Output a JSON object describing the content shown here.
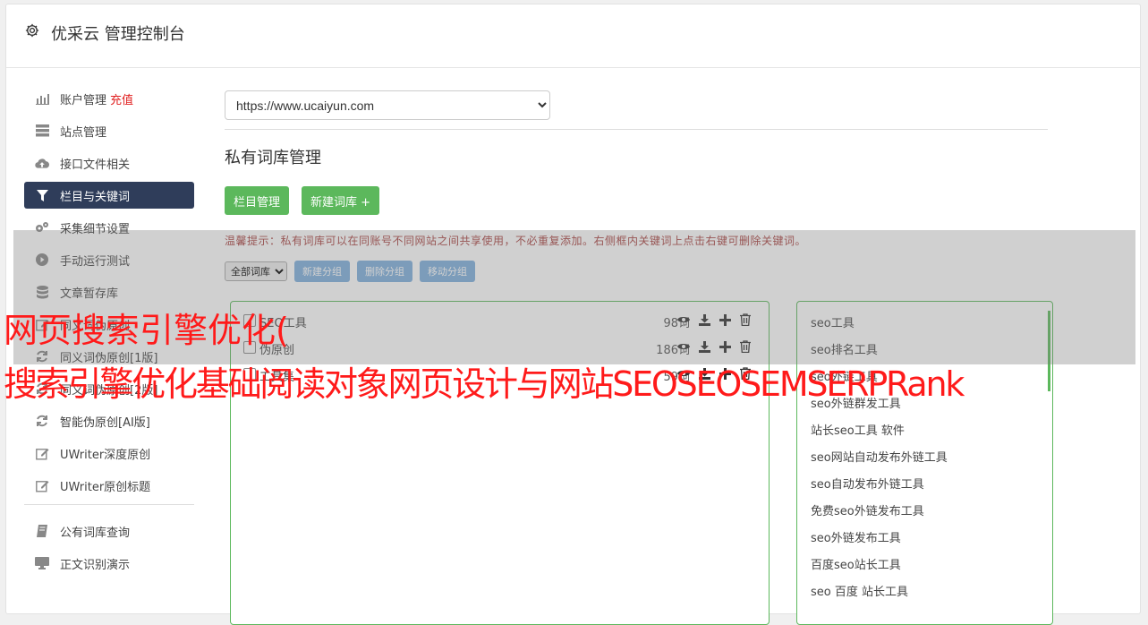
{
  "header": {
    "title": "优采云 管理控制台",
    "icon": "gear-icon"
  },
  "sidebar": {
    "items": [
      {
        "label": "账户管理",
        "badge": "充值",
        "icon": "bar-chart-icon"
      },
      {
        "label": "站点管理",
        "icon": "server-icon"
      },
      {
        "label": "接口文件相关",
        "icon": "cloud-upload-icon"
      },
      {
        "label": "栏目与关键词",
        "icon": "filter-icon",
        "active": true
      },
      {
        "label": "采集细节设置",
        "icon": "gears-icon"
      },
      {
        "label": "手动运行测试",
        "icon": "play-circle-icon"
      },
      {
        "label": "文章暂存库",
        "icon": "database-icon"
      },
      {
        "label": "同义词伪原创",
        "icon": "edit-icon"
      },
      {
        "label": "同义词伪原创[1版]",
        "icon": "refresh-icon"
      },
      {
        "label": "同义词伪原创[2版]",
        "icon": "refresh-icon"
      },
      {
        "label": "智能伪原创[AI版]",
        "icon": "refresh-icon"
      },
      {
        "label": "UWriter深度原创",
        "icon": "edit-icon"
      },
      {
        "label": "UWriter原创标题",
        "icon": "edit-icon"
      }
    ],
    "items2": [
      {
        "label": "公有词库查询",
        "icon": "book-icon"
      },
      {
        "label": "正文识别演示",
        "icon": "monitor-icon"
      }
    ]
  },
  "main": {
    "site_url": "https://www.ucaiyun.com",
    "section_title": "私有词库管理",
    "btn_columns": "栏目管理",
    "btn_new_lib": "新建词库 +",
    "tip": "温馨提示：私有词库可以在同账号不同网站之间共享使用，不必重复添加。右侧框内关键词上点击右键可删除关键词。",
    "filter_select": "全部词库",
    "btn_new_group": "新建分组",
    "btn_delete_group": "删除分组",
    "btn_move_group": "移动分组",
    "libraries": [
      {
        "name": "SEO工具",
        "count": "98词"
      },
      {
        "name": "伪原创",
        "count": "186词"
      },
      {
        "name": "工具集",
        "count": "59词"
      }
    ],
    "keywords": [
      "seo工具",
      "seo排名工具",
      "seo外链工具",
      "seo外链群发工具",
      "站长seo工具 软件",
      "seo网站自动发布外链工具",
      "seo自动发布外链工具",
      "免费seo外链发布工具",
      "seo外链发布工具",
      "百度seo站长工具",
      "seo 百度 站长工具"
    ]
  },
  "overlay": {
    "line1": "网页搜索引擎优化(",
    "line2": "搜索引擎优化基础阅读对象网页设计与网站SEOSEOSEMSERPRank"
  },
  "colors": {
    "accent_green": "#5cb85c",
    "active_nav": "#2f3d5a",
    "tip_red": "#a94442",
    "overlay_red": "#ff1a1a"
  }
}
